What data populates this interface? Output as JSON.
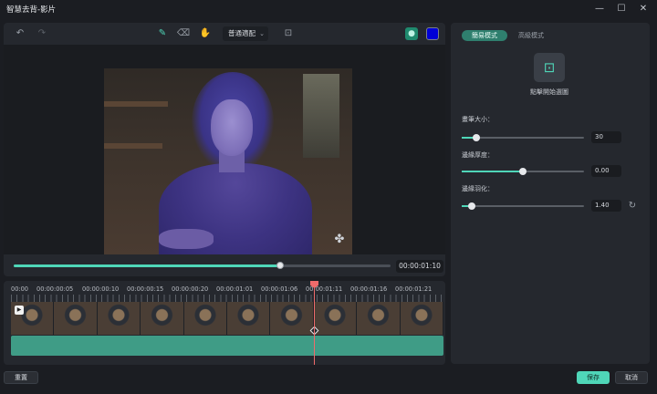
{
  "window": {
    "title": "智慧去背-影片",
    "minimize_icon": "minimize-icon",
    "maximize_icon": "maximize-icon",
    "close_icon": "close-icon"
  },
  "toolbar": {
    "undo_icon": "undo-icon",
    "redo_icon": "redo-icon",
    "smart_brush_icon": "magic-brush-icon",
    "eraser_icon": "eraser-icon",
    "hand_icon": "hand-icon",
    "mode_select": "普通適配",
    "fit_icon": "fit-screen-icon",
    "person_icon": "person-icon",
    "background_color": "#0000d6"
  },
  "player": {
    "current_time": "00:00:01:10",
    "progress_fraction": 0.707,
    "zoom_fraction": 0.05
  },
  "timeline": {
    "ruler_labels": [
      "00:00",
      "00:00:00:05",
      "00:00:00:10",
      "00:00:00:15",
      "00:00:00:20",
      "00:00:01:01",
      "00:00:01:06",
      "00:00:01:11",
      "00:00:01:16",
      "00:00:01:21"
    ],
    "frame_count": 10,
    "track_color": "#3f9c86"
  },
  "settings": {
    "tabs": [
      "簡易模式",
      "高級模式"
    ],
    "active_tab": 0,
    "click_select_label": "點擊開始選圖",
    "params": [
      {
        "label": "畫筆大小：",
        "value": "30",
        "fraction": 0.12
      },
      {
        "label": "邊緣厚度：",
        "value": "0.00",
        "fraction": 0.5
      },
      {
        "label": "邊緣羽化：",
        "value": "1.40",
        "fraction": 0.08
      }
    ]
  },
  "footer": {
    "reset_label": "重置",
    "save_label": "保存",
    "cancel_label": "取消"
  },
  "colors": {
    "accent": "#4fd6b8",
    "playhead": "#ef6b6b"
  }
}
